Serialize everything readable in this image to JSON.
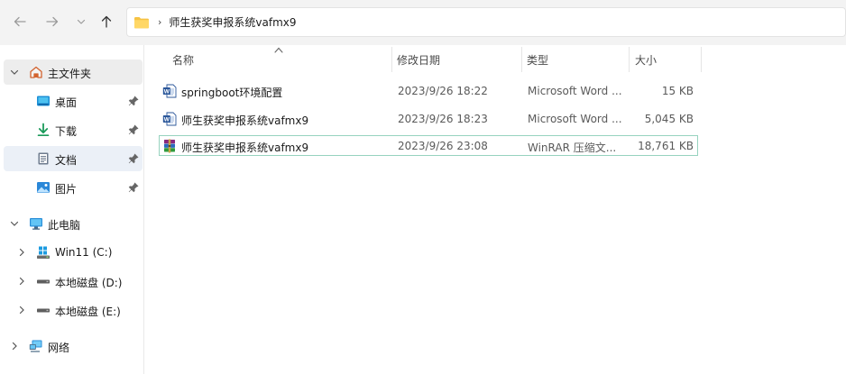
{
  "toolbar": {
    "back_icon": "arrow-left-icon",
    "forward_icon": "arrow-right-icon",
    "recent_icon": "chevron-down-icon",
    "up_icon": "arrow-up-icon"
  },
  "address": {
    "folder_icon": "folder-icon",
    "separator": "›",
    "crumb": "师生获奖申报系统vafmx9"
  },
  "sidebar": {
    "items": [
      {
        "label": "主文件夹",
        "icon": "home-icon"
      },
      {
        "label": "桌面",
        "icon": "desktop-icon",
        "pinned": true
      },
      {
        "label": "下载",
        "icon": "download-icon",
        "pinned": true
      },
      {
        "label": "文档",
        "icon": "document-icon",
        "pinned": true
      },
      {
        "label": "图片",
        "icon": "picture-icon",
        "pinned": true
      },
      {
        "label": "此电脑",
        "icon": "computer-icon"
      },
      {
        "label": "Win11 (C:)",
        "icon": "windows-drive-icon"
      },
      {
        "label": "本地磁盘 (D:)",
        "icon": "drive-icon"
      },
      {
        "label": "本地磁盘 (E:)",
        "icon": "drive-icon"
      },
      {
        "label": "网络",
        "icon": "network-icon"
      }
    ]
  },
  "columns": {
    "name": "名称",
    "date": "修改日期",
    "type": "类型",
    "size": "大小"
  },
  "files": [
    {
      "name": "springboot环境配置",
      "date": "2023/9/26 18:22",
      "type": "Microsoft Word ...",
      "size": "15 KB",
      "icon": "word-document-icon"
    },
    {
      "name": "师生获奖申报系统vafmx9",
      "date": "2023/9/26 18:23",
      "type": "Microsoft Word ...",
      "size": "5,045 KB",
      "icon": "word-document-icon"
    },
    {
      "name": "师生获奖申报系统vafmx9",
      "date": "2023/9/26 23:08",
      "type": "WinRAR 压缩文...",
      "size": "18,761 KB",
      "icon": "winrar-archive-icon"
    }
  ],
  "colors": {
    "topbar_bg": "#f3f3f3",
    "selected_border": "#97d3bf",
    "folder_yellow": "#f6c344",
    "word_blue": "#2b579a"
  }
}
